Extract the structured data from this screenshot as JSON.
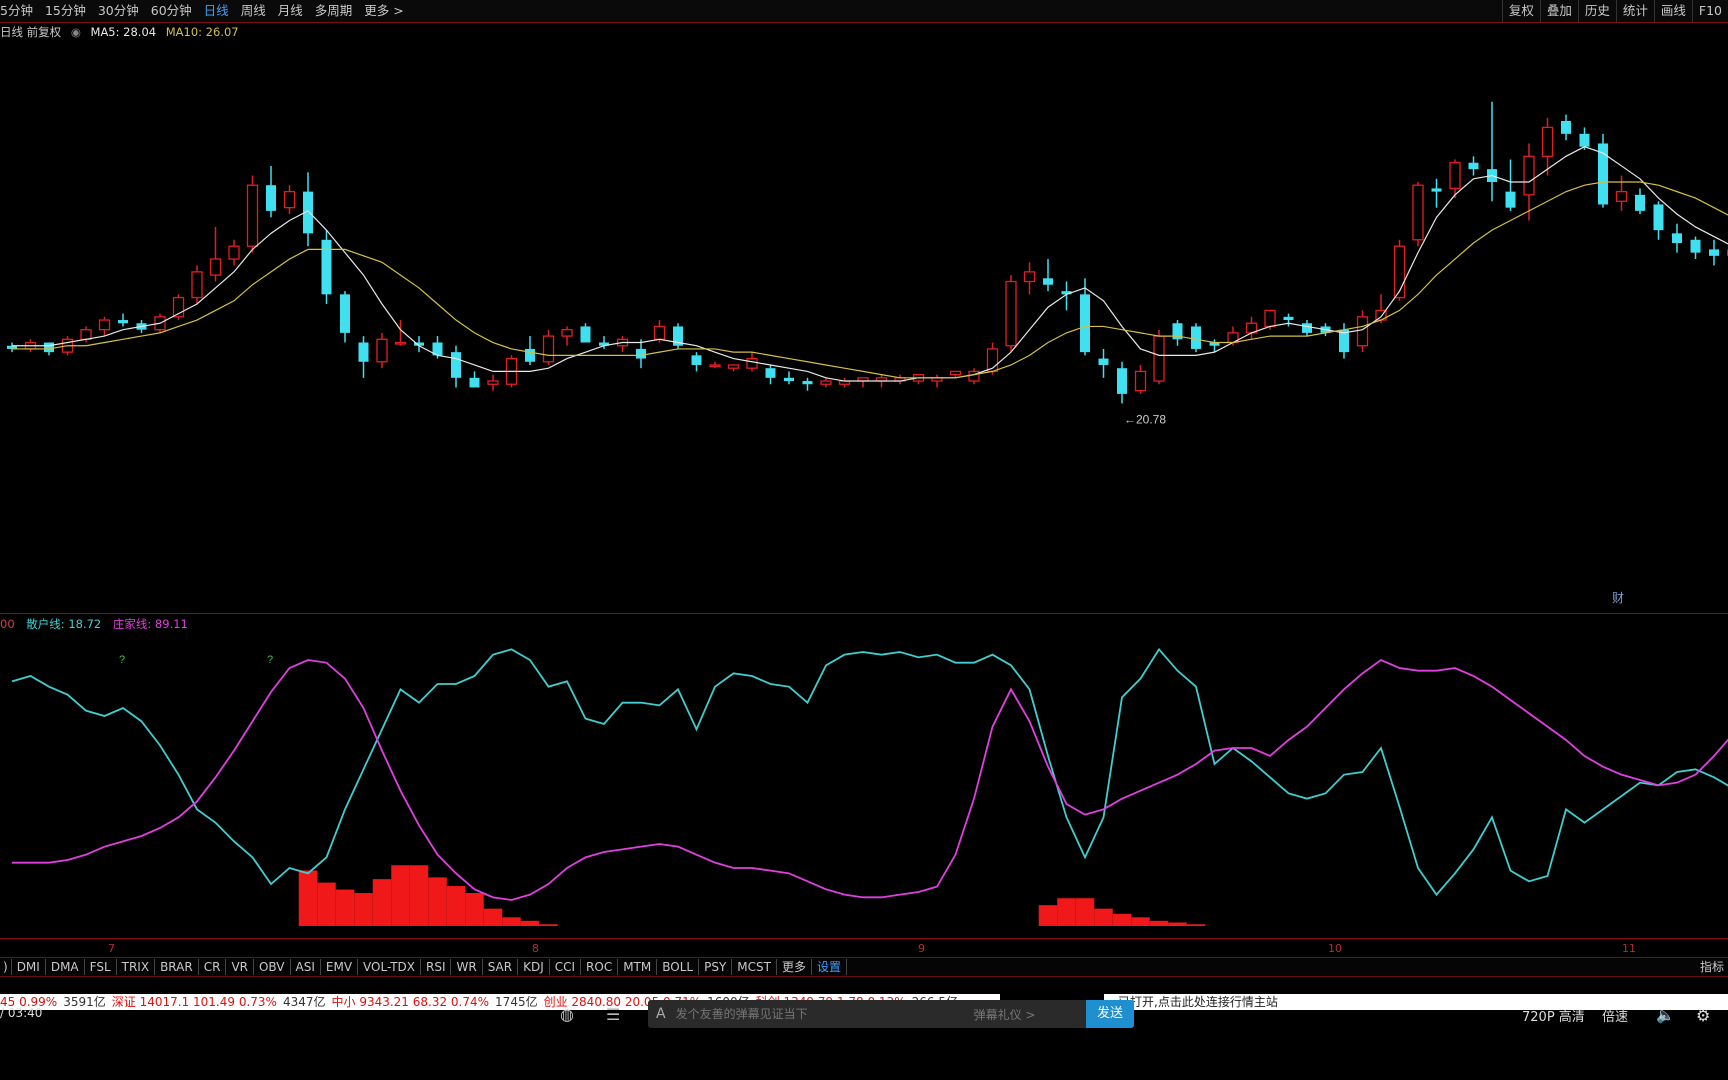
{
  "toolbar": {
    "tabs": [
      "5分钟",
      "15分钟",
      "30分钟",
      "60分钟",
      "日线",
      "周线",
      "月线",
      "多周期",
      "更多 >"
    ],
    "active": "日线",
    "right": [
      "复权",
      "叠加",
      "历史",
      "统计",
      "画线",
      "F10"
    ]
  },
  "info": {
    "label": "日线 前复权",
    "ma5": "MA5: 28.04",
    "ma10": "MA10: 26.07",
    "ma5_color": "#e8e8e8",
    "ma10_color": "#d4c040"
  },
  "price_low_label": "←20.78",
  "corner_marks": [
    "财",
    "?"
  ],
  "indicator_legend": {
    "prefix": "00",
    "retail_label": "散户线: 18.72",
    "retail_color": "#3fcfd0",
    "main_label": "庄家线: 89.11",
    "main_color": "#e040e0"
  },
  "indicator_marks": [
    "?",
    "?",
    "?",
    "?",
    "?"
  ],
  "date_labels": [
    "7",
    "8",
    "9",
    "10",
    "11"
  ],
  "indicator_tabs": [
    "DMI",
    "DMA",
    "FSL",
    "TRIX",
    "BRAR",
    "CR",
    "VR",
    "OBV",
    "ASI",
    "EMV",
    "VOL-TDX",
    "RSI",
    "WR",
    "SAR",
    "KDJ",
    "CCI",
    "ROC",
    "MTM",
    "BOLL",
    "PSY",
    "MCST",
    "更多",
    "设置"
  ],
  "indicator_right": "指标",
  "status": {
    "items": [
      {
        "t": "45  0.99%",
        "c": "red"
      },
      {
        "t": "3591亿",
        "c": "dark"
      },
      {
        "t": "深证 14017.1  101.49  0.73%",
        "c": "red2"
      },
      {
        "t": "4347亿",
        "c": "dark"
      },
      {
        "t": "中小 9343.21  68.32  0.74%",
        "c": "red2"
      },
      {
        "t": "1745亿",
        "c": "dark"
      },
      {
        "t": "创业 2840.80  20.05  0.71%",
        "c": "red2"
      },
      {
        "t": "1600亿",
        "c": "dark"
      },
      {
        "t": "科创 1349.79  1.78  0.13%",
        "c": "red2"
      },
      {
        "t": "266.5亿",
        "c": "dark"
      }
    ],
    "notice": "已打开,点击此处连接行情主站"
  },
  "player": {
    "time": "/ 03:40",
    "danmu_placeholder": "发个友善的弹幕见证当下",
    "danmu_etiquette": "弹幕礼仪 >",
    "send": "发送",
    "quality": "720P 高清",
    "speed": "倍速"
  },
  "chart_data": {
    "type": "candlestick",
    "candles": [
      [
        22.3,
        22.4,
        22.1,
        22.2
      ],
      [
        22.2,
        22.5,
        22.1,
        22.4
      ],
      [
        22.4,
        22.4,
        22.0,
        22.1
      ],
      [
        22.1,
        22.6,
        22.0,
        22.5
      ],
      [
        22.5,
        22.9,
        22.4,
        22.8
      ],
      [
        22.8,
        23.2,
        22.6,
        23.1
      ],
      [
        23.1,
        23.3,
        22.9,
        23.0
      ],
      [
        23.0,
        23.1,
        22.7,
        22.8
      ],
      [
        22.8,
        23.3,
        22.7,
        23.2
      ],
      [
        23.2,
        23.9,
        23.1,
        23.8
      ],
      [
        23.8,
        24.8,
        23.6,
        24.6
      ],
      [
        24.5,
        26.0,
        24.3,
        25.0
      ],
      [
        25.0,
        25.6,
        24.8,
        25.4
      ],
      [
        25.4,
        27.6,
        25.2,
        27.3
      ],
      [
        27.3,
        27.9,
        26.3,
        26.5
      ],
      [
        26.6,
        27.3,
        26.4,
        27.1
      ],
      [
        27.1,
        27.7,
        25.4,
        25.8
      ],
      [
        25.6,
        25.9,
        23.6,
        23.9
      ],
      [
        23.9,
        24.0,
        22.4,
        22.7
      ],
      [
        22.4,
        22.6,
        21.3,
        21.8
      ],
      [
        21.8,
        22.7,
        21.6,
        22.5
      ],
      [
        22.4,
        23.1,
        22.3,
        22.4
      ],
      [
        22.4,
        22.6,
        22.1,
        22.3
      ],
      [
        22.4,
        22.6,
        21.9,
        22.0
      ],
      [
        22.1,
        22.3,
        21.0,
        21.3
      ],
      [
        21.3,
        21.5,
        21.0,
        21.0
      ],
      [
        21.1,
        21.4,
        20.9,
        21.2
      ],
      [
        21.1,
        22.0,
        21.0,
        21.9
      ],
      [
        22.2,
        22.6,
        21.7,
        21.8
      ],
      [
        21.8,
        22.8,
        21.7,
        22.6
      ],
      [
        22.6,
        22.9,
        22.3,
        22.8
      ],
      [
        22.9,
        23.0,
        22.5,
        22.4
      ],
      [
        22.4,
        22.6,
        22.2,
        22.3
      ],
      [
        22.3,
        22.6,
        22.1,
        22.5
      ],
      [
        22.2,
        22.5,
        21.6,
        21.9
      ],
      [
        22.5,
        23.1,
        22.4,
        22.9
      ],
      [
        22.9,
        23.0,
        22.2,
        22.3
      ],
      [
        22.0,
        22.1,
        21.5,
        21.7
      ],
      [
        21.7,
        21.8,
        21.6,
        21.7
      ],
      [
        21.6,
        21.7,
        21.5,
        21.7
      ],
      [
        21.6,
        22.1,
        21.5,
        21.9
      ],
      [
        21.6,
        21.7,
        21.1,
        21.3
      ],
      [
        21.3,
        21.5,
        21.1,
        21.2
      ],
      [
        21.2,
        21.3,
        20.9,
        21.1
      ],
      [
        21.1,
        21.3,
        21.0,
        21.2
      ],
      [
        21.1,
        21.3,
        21.0,
        21.2
      ],
      [
        21.2,
        21.3,
        21.0,
        21.3
      ],
      [
        21.2,
        21.4,
        21.0,
        21.3
      ],
      [
        21.2,
        21.4,
        21.1,
        21.3
      ],
      [
        21.2,
        21.4,
        21.1,
        21.4
      ],
      [
        21.2,
        21.4,
        21.0,
        21.3
      ],
      [
        21.4,
        21.4,
        21.3,
        21.5
      ],
      [
        21.2,
        21.6,
        21.1,
        21.5
      ],
      [
        21.5,
        22.4,
        21.4,
        22.2
      ],
      [
        22.3,
        24.5,
        22.1,
        24.3
      ],
      [
        24.3,
        24.9,
        23.9,
        24.6
      ],
      [
        24.4,
        25.0,
        24.0,
        24.2
      ],
      [
        24.0,
        24.3,
        23.4,
        23.9
      ],
      [
        23.9,
        24.4,
        22.0,
        22.1
      ],
      [
        21.9,
        22.2,
        21.3,
        21.7
      ],
      [
        21.6,
        21.8,
        20.5,
        20.8
      ],
      [
        20.9,
        21.7,
        20.8,
        21.5
      ],
      [
        21.2,
        22.8,
        21.1,
        22.6
      ],
      [
        23.0,
        23.1,
        22.3,
        22.5
      ],
      [
        22.9,
        23.0,
        22.1,
        22.2
      ],
      [
        22.4,
        22.5,
        22.1,
        22.3
      ],
      [
        22.4,
        22.9,
        22.3,
        22.7
      ],
      [
        22.7,
        23.2,
        22.5,
        23.0
      ],
      [
        22.9,
        23.4,
        22.8,
        23.4
      ],
      [
        23.2,
        23.3,
        22.9,
        23.1
      ],
      [
        23.0,
        23.1,
        22.6,
        22.7
      ],
      [
        22.9,
        23.0,
        22.6,
        22.7
      ],
      [
        22.8,
        23.0,
        21.9,
        22.1
      ],
      [
        22.3,
        23.4,
        22.1,
        23.2
      ],
      [
        23.1,
        23.9,
        23.0,
        23.4
      ],
      [
        23.8,
        25.6,
        23.7,
        25.4
      ],
      [
        25.6,
        27.4,
        25.4,
        27.3
      ],
      [
        27.2,
        27.5,
        26.6,
        27.1
      ],
      [
        27.2,
        28.1,
        26.9,
        28.0
      ],
      [
        28.0,
        28.2,
        27.6,
        27.8
      ],
      [
        27.8,
        29.9,
        26.8,
        27.4
      ],
      [
        27.1,
        28.1,
        26.5,
        26.6
      ],
      [
        27.0,
        28.6,
        26.2,
        28.2
      ],
      [
        28.2,
        29.4,
        27.6,
        29.1
      ],
      [
        29.3,
        29.5,
        28.7,
        28.9
      ],
      [
        28.9,
        29.1,
        28.4,
        28.5
      ],
      [
        28.6,
        28.9,
        26.6,
        26.7
      ],
      [
        26.8,
        27.6,
        26.5,
        27.1
      ],
      [
        27.0,
        27.2,
        26.4,
        26.5
      ],
      [
        26.7,
        26.8,
        25.6,
        25.9
      ],
      [
        25.8,
        26.1,
        25.2,
        25.5
      ],
      [
        25.6,
        25.7,
        25.0,
        25.2
      ],
      [
        25.3,
        25.6,
        24.8,
        25.1
      ],
      [
        25.3,
        25.5,
        24.9,
        25.1
      ],
      [
        25.2,
        25.3,
        24.9,
        25.2
      ],
      [
        25.2,
        25.6,
        25.0,
        25.5
      ],
      [
        25.6,
        27.2,
        25.5,
        27.1
      ],
      [
        27.0,
        28.3,
        26.8,
        28.2
      ],
      [
        28.3,
        29.0,
        28.2,
        28.7
      ],
      [
        28.6,
        29.2,
        28.2,
        28.5
      ],
      [
        28.0,
        29.4,
        26.8,
        29.3
      ]
    ],
    "ma5_line": [
      22.3,
      22.3,
      22.3,
      22.4,
      22.5,
      22.6,
      22.8,
      22.9,
      23.0,
      23.3,
      23.6,
      24.1,
      24.6,
      25.3,
      25.8,
      26.2,
      26.5,
      25.9,
      25.2,
      24.5,
      23.6,
      22.8,
      22.3,
      22.0,
      21.9,
      21.7,
      21.5,
      21.5,
      21.5,
      21.6,
      21.9,
      22.1,
      22.3,
      22.4,
      22.4,
      22.5,
      22.4,
      22.3,
      22.1,
      21.9,
      21.8,
      21.7,
      21.6,
      21.5,
      21.3,
      21.2,
      21.2,
      21.2,
      21.2,
      21.3,
      21.3,
      21.3,
      21.4,
      21.6,
      22.1,
      22.8,
      23.5,
      23.9,
      24.1,
      23.7,
      22.9,
      22.2,
      22.0,
      22.0,
      22.0,
      22.1,
      22.4,
      22.7,
      22.9,
      23.0,
      22.9,
      22.8,
      22.7,
      22.8,
      23.2,
      24.0,
      25.2,
      26.3,
      27.0,
      27.5,
      27.6,
      27.4,
      27.4,
      27.8,
      28.2,
      28.5,
      28.3,
      27.9,
      27.5,
      26.9,
      26.4,
      26.0,
      25.7,
      25.4,
      25.2,
      25.2,
      25.5,
      26.2,
      27.1,
      28.0,
      28.5
    ],
    "ma10_line": [
      22.2,
      22.2,
      22.2,
      22.3,
      22.3,
      22.4,
      22.5,
      22.6,
      22.7,
      22.9,
      23.1,
      23.4,
      23.7,
      24.2,
      24.6,
      25.0,
      25.3,
      25.3,
      25.3,
      25.1,
      24.9,
      24.5,
      24.1,
      23.6,
      23.1,
      22.7,
      22.4,
      22.2,
      22.1,
      22.0,
      22.0,
      22.0,
      22.0,
      22.0,
      22.0,
      22.1,
      22.2,
      22.2,
      22.2,
      22.1,
      22.1,
      22.0,
      21.9,
      21.8,
      21.7,
      21.6,
      21.5,
      21.4,
      21.3,
      21.3,
      21.3,
      21.3,
      21.4,
      21.5,
      21.7,
      22.0,
      22.4,
      22.7,
      22.9,
      22.9,
      22.8,
      22.7,
      22.6,
      22.6,
      22.5,
      22.4,
      22.4,
      22.5,
      22.6,
      22.6,
      22.6,
      22.7,
      22.8,
      22.9,
      23.1,
      23.4,
      23.9,
      24.5,
      25.0,
      25.5,
      25.9,
      26.2,
      26.5,
      26.8,
      27.1,
      27.3,
      27.4,
      27.4,
      27.4,
      27.3,
      27.1,
      26.9,
      26.6,
      26.3,
      26.0,
      25.9,
      25.8,
      25.9,
      26.1,
      26.4,
      26.8
    ],
    "price_range": [
      19.6,
      31.2
    ],
    "retail_line": [
      88,
      90,
      86,
      83,
      77,
      75,
      78,
      73,
      64,
      53,
      40,
      35,
      28,
      22,
      12,
      18,
      16,
      22,
      40,
      55,
      70,
      85,
      80,
      87,
      87,
      90,
      98,
      100,
      96,
      86,
      88,
      74,
      72,
      80,
      80,
      79,
      85,
      70,
      86,
      91,
      90,
      87,
      86,
      80,
      94,
      98,
      99,
      98,
      99,
      97,
      98,
      95,
      95,
      98,
      94,
      85,
      60,
      37,
      22,
      37,
      82,
      89,
      100,
      92,
      86,
      57,
      63,
      58,
      52,
      46,
      44,
      46,
      53,
      54,
      63,
      41,
      18,
      8,
      16,
      25,
      37,
      17,
      13,
      15,
      40,
      35,
      40,
      45,
      50,
      49,
      54,
      55,
      52,
      48,
      40,
      21,
      19,
      27,
      22,
      15,
      5
    ],
    "main_line": [
      20,
      20,
      20,
      21,
      23,
      26,
      28,
      30,
      33,
      37,
      43,
      52,
      62,
      73,
      84,
      93,
      96,
      95,
      89,
      78,
      62,
      47,
      34,
      23,
      16,
      10,
      7,
      6,
      8,
      12,
      18,
      22,
      24,
      25,
      26,
      27,
      26,
      23,
      20,
      18,
      18,
      17,
      16,
      13,
      10,
      8,
      7,
      7,
      8,
      9,
      11,
      23,
      44,
      71,
      85,
      73,
      56,
      42,
      38,
      40,
      44,
      47,
      50,
      53,
      57,
      62,
      63,
      63,
      60,
      66,
      71,
      78,
      85,
      91,
      96,
      93,
      92,
      92,
      93,
      90,
      86,
      81,
      76,
      71,
      66,
      60,
      56,
      53,
      51,
      49,
      50,
      53,
      60,
      68,
      75,
      80,
      86,
      91,
      96,
      100,
      100
    ],
    "histogram": [
      [
        16,
        32
      ],
      [
        17,
        25
      ],
      [
        18,
        21
      ],
      [
        19,
        19
      ],
      [
        20,
        27
      ],
      [
        21,
        35
      ],
      [
        22,
        35
      ],
      [
        23,
        28
      ],
      [
        24,
        23
      ],
      [
        25,
        19
      ],
      [
        26,
        10
      ],
      [
        27,
        5
      ],
      [
        28,
        3
      ],
      [
        29,
        1
      ],
      [
        56,
        12
      ],
      [
        57,
        16
      ],
      [
        58,
        16
      ],
      [
        59,
        10
      ],
      [
        60,
        7
      ],
      [
        61,
        5
      ],
      [
        62,
        3
      ],
      [
        63,
        2
      ],
      [
        64,
        1
      ]
    ],
    "indicator_range": [
      0,
      105
    ]
  }
}
